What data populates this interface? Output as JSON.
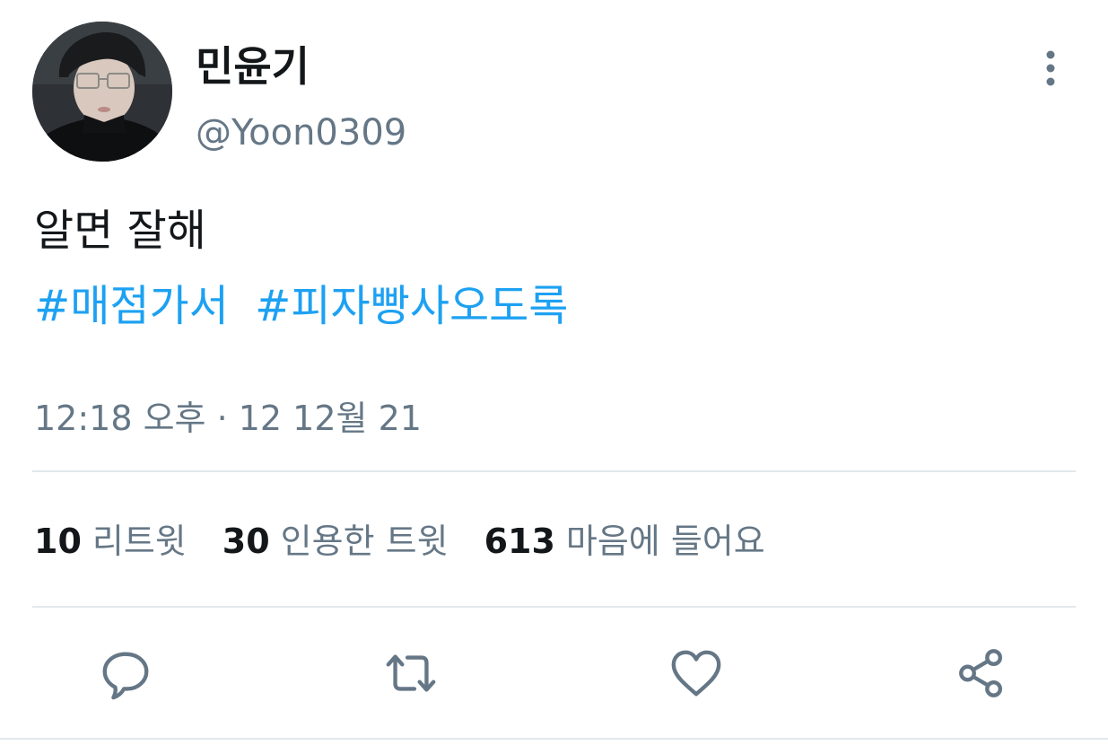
{
  "user": {
    "display_name": "민윤기",
    "handle": "@Yoon0309"
  },
  "tweet": {
    "text": "알면 잘해",
    "hashtags": [
      "#매점가서",
      "#피자빵사오도록"
    ],
    "timestamp": "12:18 오후 · 12 12월 21"
  },
  "stats": {
    "retweets": {
      "count": "10",
      "label": "리트윗"
    },
    "quotes": {
      "count": "30",
      "label": "인용한 트윗"
    },
    "likes": {
      "count": "613",
      "label": "마음에 들어요"
    }
  },
  "icons": {
    "more": "more-vertical-icon",
    "reply": "reply-icon",
    "retweet": "retweet-icon",
    "like": "heart-icon",
    "share": "share-icon"
  },
  "colors": {
    "hashtag": "#1da1f2",
    "secondary_text": "#657786",
    "icon": "#657786"
  }
}
